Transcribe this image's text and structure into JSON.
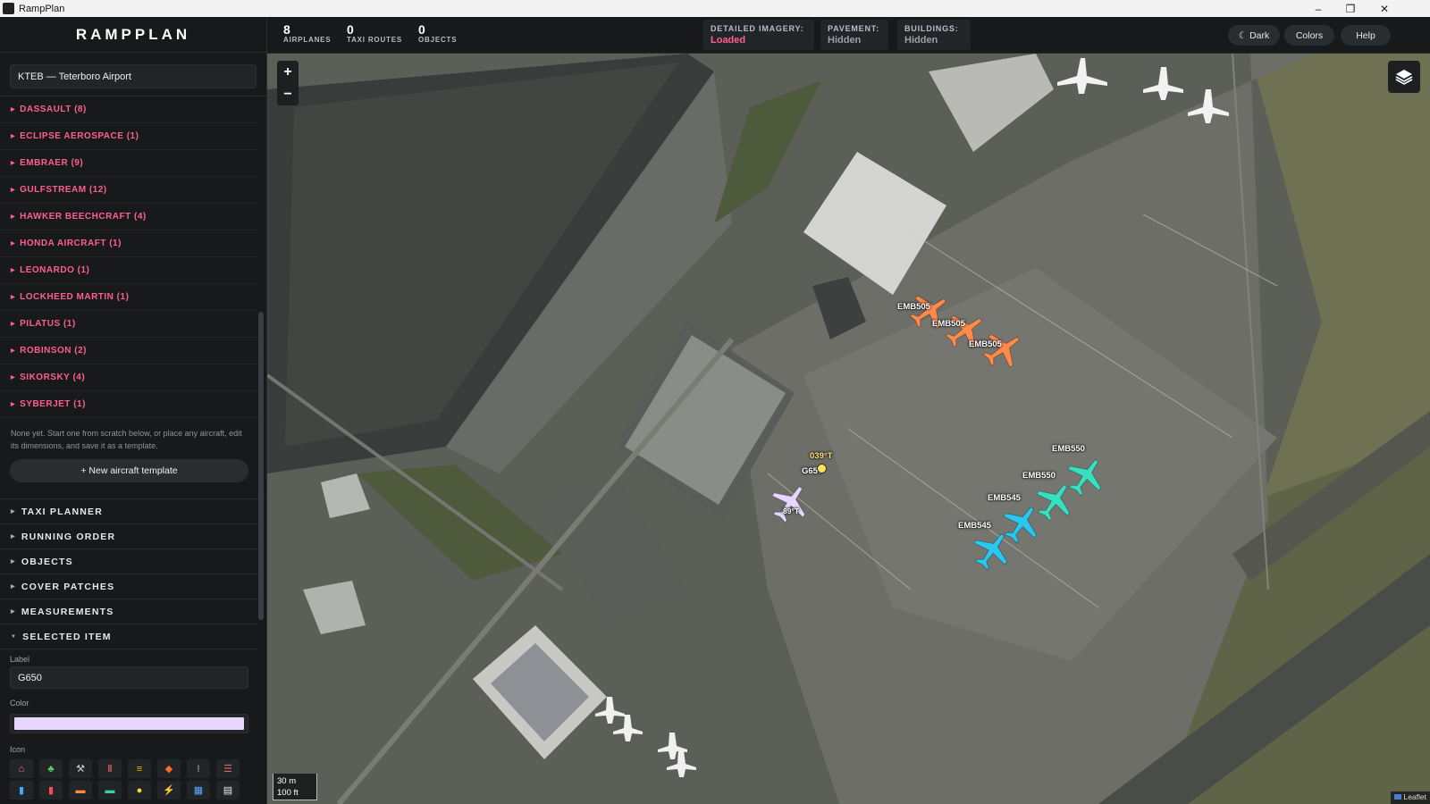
{
  "window": {
    "title": "RampPlan"
  },
  "sidebar": {
    "brand": "RAMPPLAN",
    "airport": "KTEB — Teterboro Airport",
    "manufacturers": [
      "DASSAULT (8)",
      "ECLIPSE AEROSPACE (1)",
      "EMBRAER (9)",
      "GULFSTREAM (12)",
      "HAWKER BEECHCRAFT (4)",
      "HONDA AIRCRAFT (1)",
      "LEONARDO (1)",
      "LOCKHEED MARTIN (1)",
      "PILATUS (1)",
      "ROBINSON (2)",
      "SIKORSKY (4)",
      "SYBERJET (1)"
    ],
    "templates_note": "None yet. Start one from scratch below, or place any aircraft, edit its dimensions, and save it as a template.",
    "new_template_label": "+ New aircraft template",
    "sections": [
      "TAXI PLANNER",
      "RUNNING ORDER",
      "OBJECTS",
      "COVER PATCHES",
      "MEASUREMENTS"
    ],
    "selected": {
      "header": "SELECTED ITEM",
      "label_caption": "Label",
      "label_value": "G650",
      "color_caption": "Color",
      "color_value": "#e7d7ff",
      "icon_caption": "Icon",
      "icons": [
        {
          "name": "hangar-icon",
          "glyph": "⌂",
          "color": "#ff6fa0"
        },
        {
          "name": "tree-icon",
          "glyph": "♣",
          "color": "#58d26b"
        },
        {
          "name": "tool-icon",
          "glyph": "⚒",
          "color": "#cfcfcf"
        },
        {
          "name": "barrier-icon",
          "glyph": "Ⅱ",
          "color": "#ff6b6b"
        },
        {
          "name": "hazard-stripe-icon",
          "glyph": "≡",
          "color": "#f0b400"
        },
        {
          "name": "diamond-icon",
          "glyph": "◆",
          "color": "#ff6a2b"
        },
        {
          "name": "pin-icon",
          "glyph": "ǃ",
          "color": "#bbbbbb"
        },
        {
          "name": "ladder-icon",
          "glyph": "☰",
          "color": "#d06a6a"
        },
        {
          "name": "fuel-can-icon",
          "glyph": "▮",
          "color": "#3fa9ff"
        },
        {
          "name": "fire-extinguisher-icon",
          "glyph": "▮",
          "color": "#ff4b4b"
        },
        {
          "name": "fuel-truck-icon",
          "glyph": "▬",
          "color": "#ff8a3d"
        },
        {
          "name": "tug-icon",
          "glyph": "▬",
          "color": "#39d0a0"
        },
        {
          "name": "light-bulb-icon",
          "glyph": "●",
          "color": "#ffd23f"
        },
        {
          "name": "power-icon",
          "glyph": "⚡",
          "color": "#ffb02e"
        },
        {
          "name": "gpu-icon",
          "glyph": "▦",
          "color": "#5aa8ff"
        },
        {
          "name": "clipboard-icon",
          "glyph": "▤",
          "color": "#eeeeee"
        }
      ]
    }
  },
  "topbar": {
    "stats": [
      {
        "value": "8",
        "label": "AIRPLANES"
      },
      {
        "value": "0",
        "label": "TAXI ROUTES"
      },
      {
        "value": "0",
        "label": "OBJECTS"
      }
    ],
    "layers": [
      {
        "key": "DETAILED IMAGERY:",
        "value": "Loaded",
        "color": "#ff5f8e"
      },
      {
        "key": "PAVEMENT:",
        "value": "Hidden",
        "color": "#9aa0a6"
      },
      {
        "key": "BUILDINGS:",
        "value": "Hidden",
        "color": "#9aa0a6"
      }
    ],
    "buttons": {
      "dark": "☾ Dark",
      "colors": "Colors",
      "help": "Help"
    }
  },
  "map": {
    "zoom_in": "+",
    "zoom_out": "−",
    "scale_metric": "30 m",
    "scale_imperial": "100 ft",
    "attribution": "Leaflet",
    "aircraft": [
      {
        "label": "EMB505",
        "color": "#ff8a4c"
      },
      {
        "label": "EMB505",
        "color": "#ff8a4c"
      },
      {
        "label": "EMB505",
        "color": "#ff8a4c"
      },
      {
        "label": "EMB550",
        "color": "#39e0c0"
      },
      {
        "label": "EMB550",
        "color": "#39e0c0"
      },
      {
        "label": "EMB545",
        "color": "#2ac8f0"
      },
      {
        "label": "EMB545",
        "color": "#2ac8f0"
      },
      {
        "label": "G650",
        "color": "#e7d7ff"
      }
    ],
    "selected_heading": "039°T",
    "selected_tag": "89°T"
  }
}
